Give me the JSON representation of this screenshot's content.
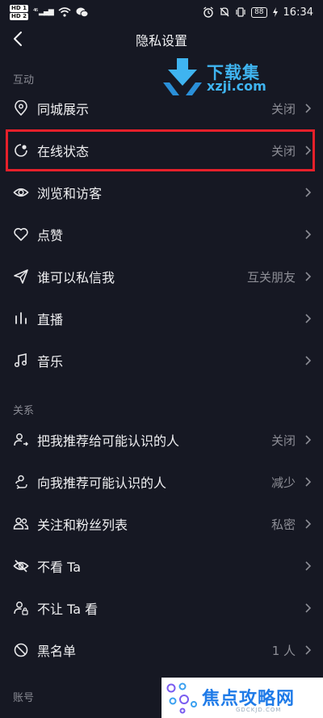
{
  "status_bar": {
    "hd1": "HD 1",
    "hd2": "HD 2",
    "signal": "⁴⁶ ▂▄▆",
    "wifi_label": "",
    "battery": "88",
    "time": "16:34"
  },
  "header": {
    "title": "隐私设置"
  },
  "watermark_top": {
    "cn": "下载集",
    "en": "xzji.com"
  },
  "sections": {
    "interaction": "互动",
    "relations": "关系",
    "account": "账号"
  },
  "rows": {
    "tongcheng": {
      "label": "同城展示",
      "value": "关闭"
    },
    "online": {
      "label": "在线状态",
      "value": "关闭"
    },
    "browse": {
      "label": "浏览和访客",
      "value": ""
    },
    "like": {
      "label": "点赞",
      "value": ""
    },
    "dm": {
      "label": "谁可以私信我",
      "value": "互关朋友"
    },
    "live": {
      "label": "直播",
      "value": ""
    },
    "music": {
      "label": "音乐",
      "value": ""
    },
    "recommend_me": {
      "label": "把我推荐给可能认识的人",
      "value": "关闭"
    },
    "recommend_to_me": {
      "label": "向我推荐可能认识的人",
      "value": "减少"
    },
    "follow_list": {
      "label": "关注和粉丝列表",
      "value": "私密"
    },
    "not_see": {
      "label": "不看 Ta",
      "value": ""
    },
    "not_let_see": {
      "label": "不让 Ta 看",
      "value": ""
    },
    "blacklist": {
      "label": "黑名单",
      "value": "1 人"
    }
  },
  "watermark_bottom": {
    "text": "焦点攻略网",
    "sub": "GDCKJD.COM"
  },
  "colors": {
    "background": "#161823",
    "highlight": "#e6202a",
    "watermark_blue": "#3fb4f0"
  }
}
